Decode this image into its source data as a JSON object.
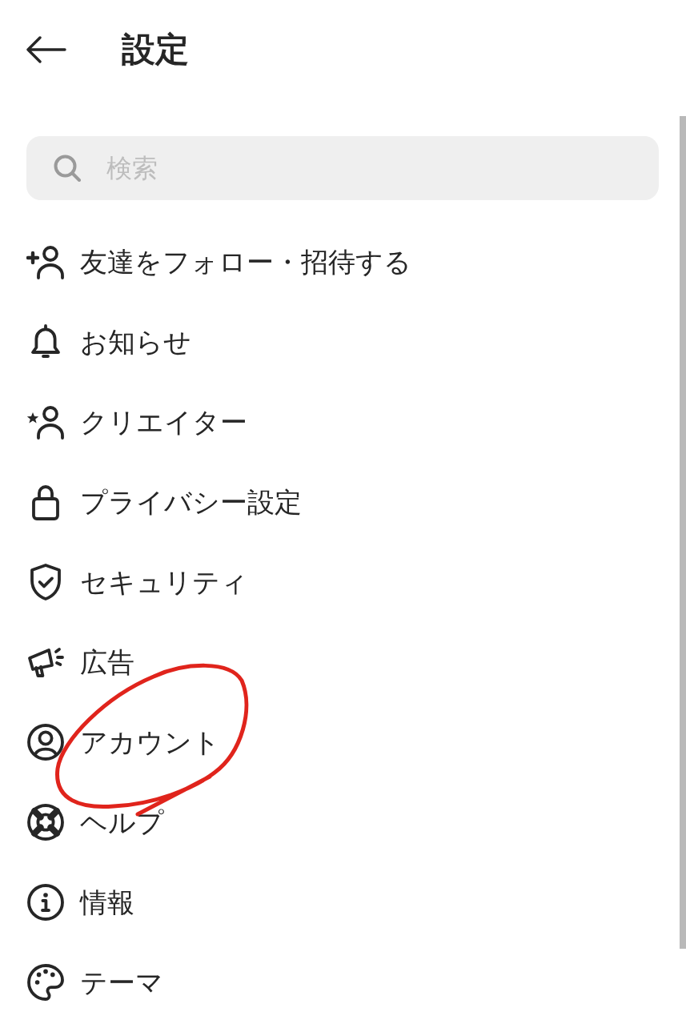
{
  "header": {
    "title": "設定"
  },
  "search": {
    "placeholder": "検索"
  },
  "items": [
    {
      "label": "友達をフォロー・招待する",
      "circled": false
    },
    {
      "label": "お知らせ",
      "circled": false
    },
    {
      "label": "クリエイター",
      "circled": false
    },
    {
      "label": "プライバシー設定",
      "circled": false
    },
    {
      "label": "セキュリティ",
      "circled": false
    },
    {
      "label": "広告",
      "circled": false
    },
    {
      "label": "アカウント",
      "circled": true
    },
    {
      "label": "ヘルプ",
      "circled": false
    },
    {
      "label": "情報",
      "circled": false
    },
    {
      "label": "テーマ",
      "circled": false
    }
  ]
}
